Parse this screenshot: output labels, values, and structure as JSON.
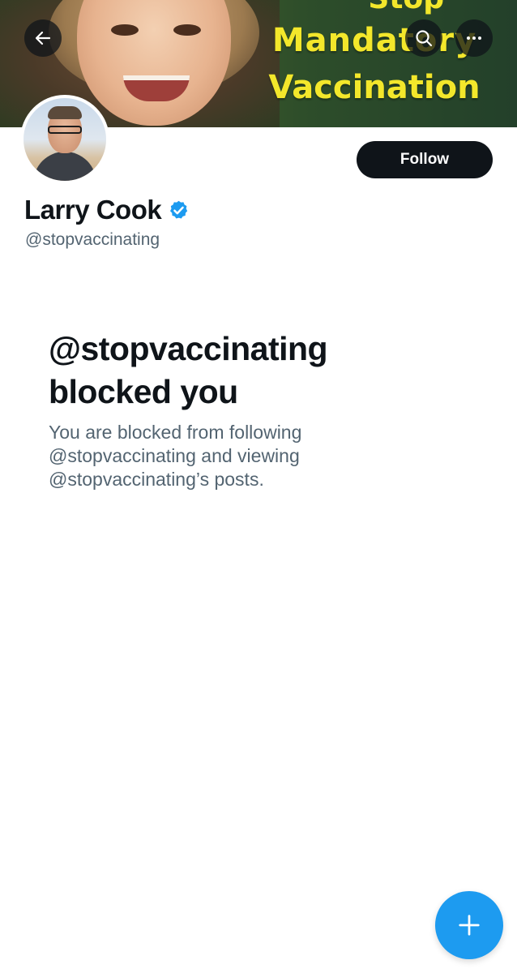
{
  "banner": {
    "text_top": "Stop",
    "text_line1": "Mandatory",
    "text_line2": "Vaccination"
  },
  "header": {
    "back_icon": "arrow-left-icon",
    "search_icon": "search-icon",
    "more_icon": "more-horizontal-icon"
  },
  "profile": {
    "display_name": "Larry Cook",
    "handle": "@stopvaccinating",
    "verified_badge": "verified-badge-icon",
    "follow_label": "Follow"
  },
  "blocked": {
    "title_line1": "@stopvaccinating",
    "title_line2": "blocked you",
    "description_line1": "You are blocked from following",
    "description_line2": "@stopvaccinating and viewing",
    "description_line3": "@stopvaccinating’s posts."
  },
  "fab": {
    "icon": "plus-icon"
  },
  "colors": {
    "accent": "#1d9bf0",
    "text_primary": "#0f1419",
    "text_secondary": "#536471",
    "banner_text": "#f3e72b"
  }
}
